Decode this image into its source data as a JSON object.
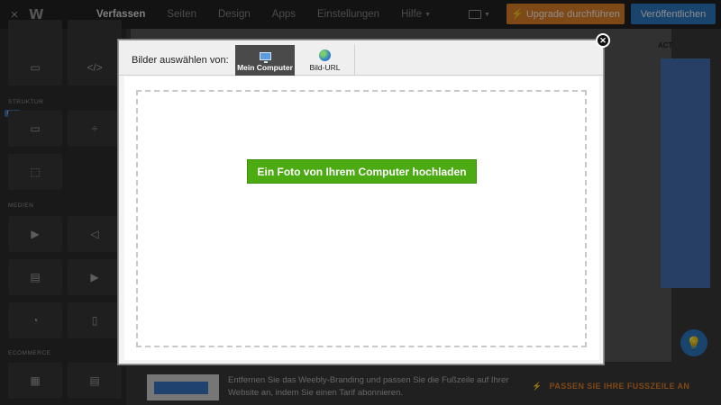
{
  "topbar": {
    "close_icon": "×",
    "logo": "W",
    "nav": [
      "Verfassen",
      "Seiten",
      "Design",
      "Apps",
      "Einstellungen",
      "Hilfe"
    ],
    "active_nav": "Verfassen",
    "upgrade_label": "Upgrade durchführen",
    "publish_label": "Veröffentlichen",
    "accent_upgrade": "#e8832a",
    "accent_publish": "#2f7dc6"
  },
  "sidebar": {
    "section_structure": "STRUKTUR",
    "badge_new": "NEU",
    "section_media": "MEDIEN",
    "section_ecommerce": "ECOMMERCE"
  },
  "background": {
    "act_text": "ACT",
    "footer_text": "Entfernen Sie das Weebly-Branding und passen Sie die Fußzeile auf Ihrer Website an, indem Sie einen Tarif abonnieren.",
    "footer_link": "PASSEN SIE IHRE FUSSZEILE AN"
  },
  "modal": {
    "select_label": "Bilder auswählen von:",
    "tabs": [
      {
        "label": "Mein Computer",
        "icon": "computer-icon",
        "active": true
      },
      {
        "label": "Bild-URL",
        "icon": "globe-icon",
        "active": false
      }
    ],
    "upload_button": "Ein Foto von Ihrem Computer hochladen",
    "close_icon": "✕",
    "upload_color": "#4caa13"
  }
}
